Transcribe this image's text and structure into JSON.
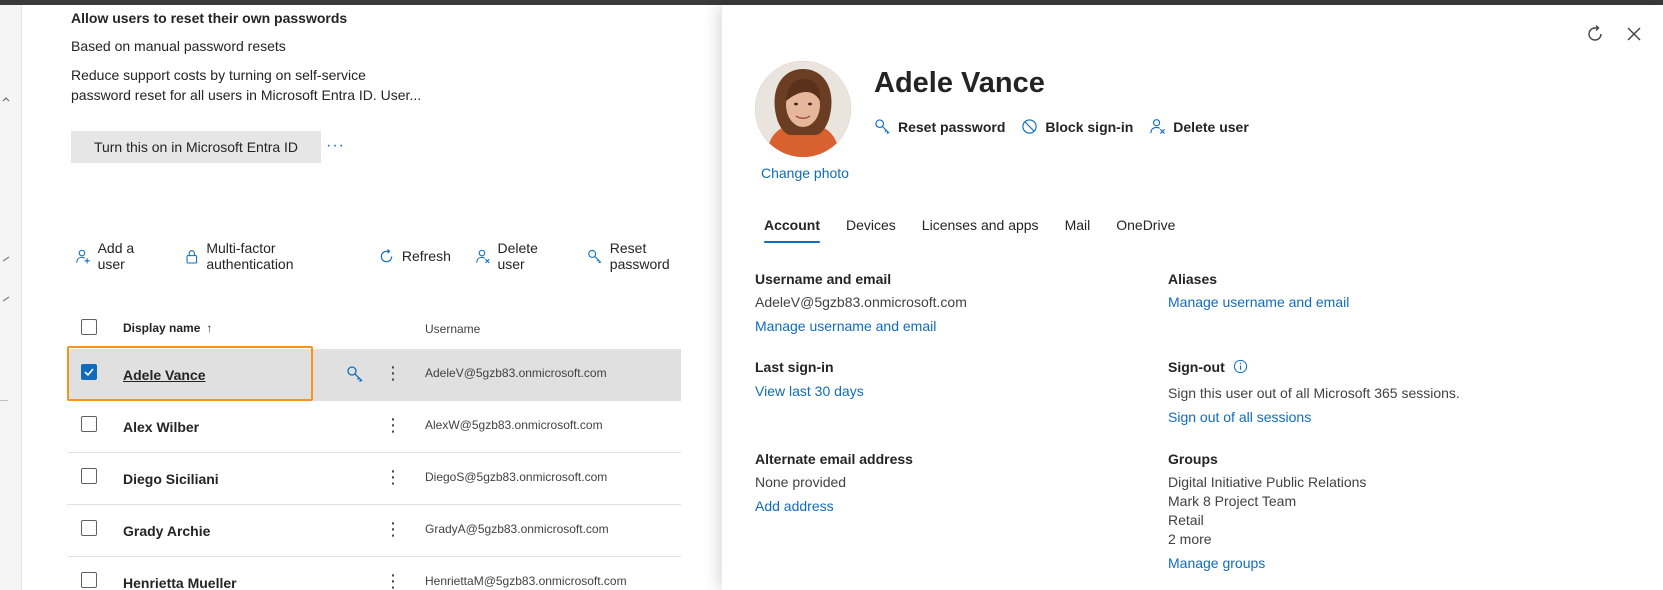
{
  "promo": {
    "title": "Allow users to reset their own passwords",
    "subtitle": "Based on manual password resets",
    "description_line1": "Reduce support costs by turning on self-service",
    "description_line2": "password reset for all users in Microsoft Entra ID. User...",
    "button_label": "Turn this on in Microsoft Entra ID",
    "more_label": "···"
  },
  "toolbar": {
    "add_user": "Add a user",
    "mfa": "Multi-factor authentication",
    "refresh": "Refresh",
    "delete_user": "Delete user",
    "reset_password": "Reset password"
  },
  "table": {
    "columns": {
      "display_name": "Display name",
      "sort_indicator": "↑",
      "username": "Username"
    },
    "rows": [
      {
        "name": "Adele Vance",
        "username": "AdeleV@5gzb83.onmicrosoft.com",
        "selected": true
      },
      {
        "name": "Alex Wilber",
        "username": "AlexW@5gzb83.onmicrosoft.com",
        "selected": false
      },
      {
        "name": "Diego Siciliani",
        "username": "DiegoS@5gzb83.onmicrosoft.com",
        "selected": false
      },
      {
        "name": "Grady Archie",
        "username": "GradyA@5gzb83.onmicrosoft.com",
        "selected": false
      },
      {
        "name": "Henrietta Mueller",
        "username": "HenriettaM@5gzb83.onmicrosoft.com",
        "selected": false
      }
    ],
    "row_more": "⋮"
  },
  "panel": {
    "user_name": "Adele Vance",
    "change_photo": "Change photo",
    "actions": {
      "reset_password": "Reset password",
      "block_signin": "Block sign-in",
      "delete_user": "Delete user"
    },
    "tabs": [
      "Account",
      "Devices",
      "Licenses and apps",
      "Mail",
      "OneDrive"
    ],
    "active_tab": "Account",
    "username_section": {
      "title": "Username and email",
      "value": "AdeleV@5gzb83.onmicrosoft.com",
      "link": "Manage username and email"
    },
    "aliases_section": {
      "title": "Aliases",
      "link": "Manage username and email"
    },
    "last_signin_section": {
      "title": "Last sign-in",
      "link": "View last 30 days"
    },
    "signout_section": {
      "title": "Sign-out",
      "text": "Sign this user out of all Microsoft 365 sessions.",
      "link": "Sign out of all sessions"
    },
    "alt_email_section": {
      "title": "Alternate email address",
      "value": "None provided",
      "link": "Add address"
    },
    "groups_section": {
      "title": "Groups",
      "items": [
        "Digital Initiative Public Relations",
        "Mark 8 Project Team",
        "Retail",
        "2 more"
      ],
      "link": "Manage groups"
    }
  },
  "colors": {
    "accent": "#0f6cbd",
    "focus_outline": "#f7941d",
    "selected_row": "#e0e0e0"
  }
}
